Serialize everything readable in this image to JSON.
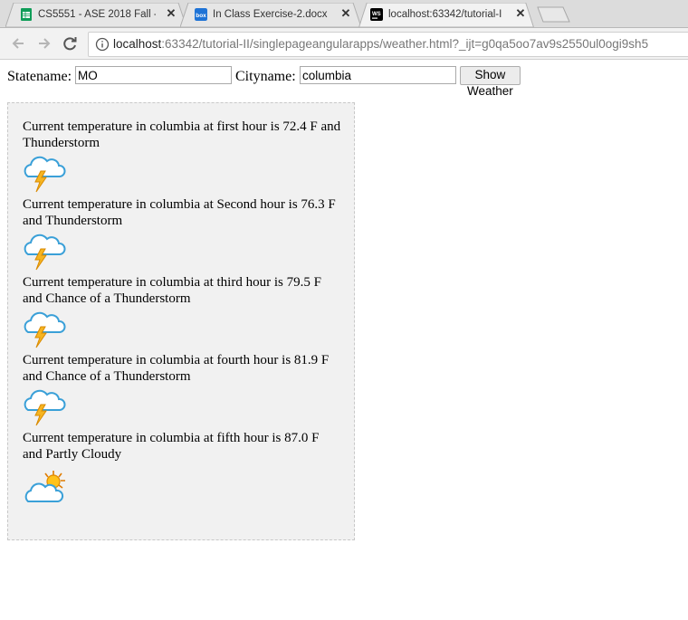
{
  "browser": {
    "tabs": [
      {
        "title": "CS5551 - ASE 2018 Fall -",
        "icon": "sheets-icon",
        "active": false
      },
      {
        "title": "In Class Exercise-2.docx |",
        "icon": "box-icon",
        "active": false
      },
      {
        "title": "localhost:63342/tutorial-I",
        "icon": "webstorm-icon",
        "active": true
      }
    ],
    "url_host": "localhost",
    "url_rest": ":63342/tutorial-II/singlepageangularapps/weather.html?_ijt=g0qa5oo7av9s2550ul0ogi9sh5"
  },
  "form": {
    "state_label": "Statename:",
    "state_value": "MO",
    "city_label": "Cityname:",
    "city_value": "columbia",
    "button_label": "Show Weather"
  },
  "forecast": [
    {
      "text": "Current temperature in columbia at first hour is 72.4 F and Thunderstorm",
      "icon": "thunderstorm-icon"
    },
    {
      "text": "Current temperature in columbia at Second hour is 76.3 F and Thunderstorm",
      "icon": "thunderstorm-icon"
    },
    {
      "text": "Current temperature in columbia at third hour is 79.5 F and Chance of a Thunderstorm",
      "icon": "thunderstorm-icon"
    },
    {
      "text": "Current temperature in columbia at fourth hour is 81.9 F and Chance of a Thunderstorm",
      "icon": "thunderstorm-icon"
    },
    {
      "text": "Current temperature in columbia at fifth hour is 87.0 F and Partly Cloudy",
      "icon": "partly-cloudy-icon"
    }
  ]
}
